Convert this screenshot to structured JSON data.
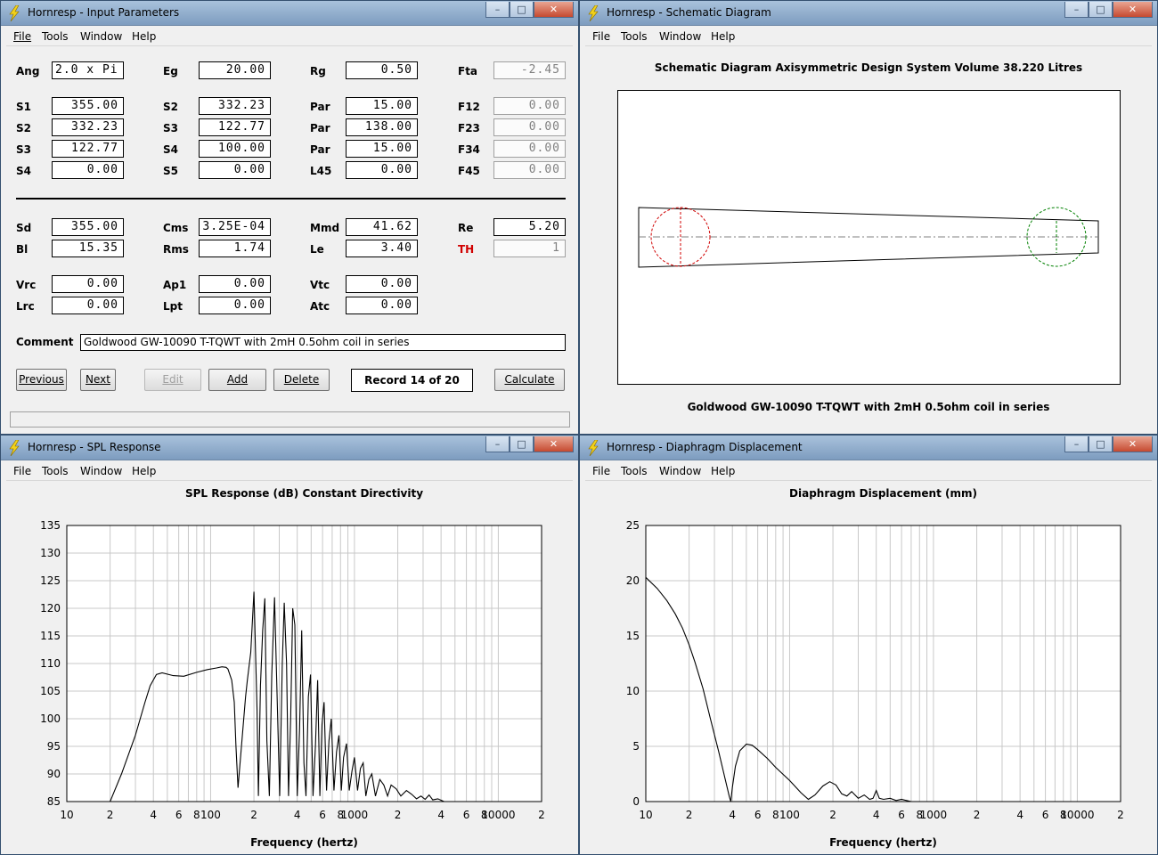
{
  "menu": {
    "file": "File",
    "tools": "Tools",
    "window": "Window",
    "help": "Help"
  },
  "input_window": {
    "title": "Hornresp - Input Parameters",
    "fields": [
      {
        "label": "Ang",
        "value": "2.0 x Pi"
      },
      {
        "label": "Eg",
        "value": "20.00"
      },
      {
        "label": "Rg",
        "value": "0.50"
      },
      {
        "label": "Fta",
        "value": "-2.45"
      },
      {
        "label": "S1",
        "value": "355.00"
      },
      {
        "label": "S2",
        "value": "332.23"
      },
      {
        "label": "Par",
        "value": "15.00"
      },
      {
        "label": "F12",
        "value": "0.00"
      },
      {
        "label": "S2",
        "value": "332.23"
      },
      {
        "label": "S3",
        "value": "122.77"
      },
      {
        "label": "Par",
        "value": "138.00"
      },
      {
        "label": "F23",
        "value": "0.00"
      },
      {
        "label": "S3",
        "value": "122.77"
      },
      {
        "label": "S4",
        "value": "100.00"
      },
      {
        "label": "Par",
        "value": "15.00"
      },
      {
        "label": "F34",
        "value": "0.00"
      },
      {
        "label": "S4",
        "value": "0.00"
      },
      {
        "label": "S5",
        "value": "0.00"
      },
      {
        "label": "L45",
        "value": "0.00"
      },
      {
        "label": "F45",
        "value": "0.00"
      },
      {
        "label": "Sd",
        "value": "355.00"
      },
      {
        "label": "Cms",
        "value": "3.25E-04"
      },
      {
        "label": "Mmd",
        "value": "41.62"
      },
      {
        "label": "Re",
        "value": "5.20"
      },
      {
        "label": "Bl",
        "value": "15.35"
      },
      {
        "label": "Rms",
        "value": "1.74"
      },
      {
        "label": "Le",
        "value": "3.40"
      },
      {
        "label": "TH",
        "value": "1"
      },
      {
        "label": "Vrc",
        "value": "0.00"
      },
      {
        "label": "Ap1",
        "value": "0.00"
      },
      {
        "label": "Vtc",
        "value": "0.00"
      },
      {
        "label": "Lrc",
        "value": "0.00"
      },
      {
        "label": "Lpt",
        "value": "0.00"
      },
      {
        "label": "Atc",
        "value": "0.00"
      }
    ],
    "comment_label": "Comment",
    "comment_value": "Goldwood GW-10090 T-TQWT with 2mH 0.5ohm coil in series",
    "buttons": {
      "previous": "Previous",
      "next": "Next",
      "edit": "Edit",
      "add": "Add",
      "delete": "Delete",
      "calculate": "Calculate"
    },
    "record": "Record 14 of 20"
  },
  "schematic_window": {
    "title": "Hornresp - Schematic Diagram",
    "header": "Schematic Diagram   Axisymmetric Design   System Volume 38.220 Litres",
    "caption": "Goldwood GW-10090 T-TQWT with 2mH 0.5ohm coil in series"
  },
  "spl_window": {
    "title": "Hornresp - SPL Response"
  },
  "disp_window": {
    "title": "Hornresp - Diaphragm Displacement"
  },
  "chart_data": [
    {
      "type": "line",
      "title": "SPL Response (dB)   Constant Directivity",
      "xlabel": "Frequency (hertz)",
      "ylabel": "",
      "xscale": "log",
      "xlim": [
        10,
        20000
      ],
      "ylim": [
        85,
        135
      ],
      "x_tick_labels": [
        "10",
        "2",
        "4",
        "6",
        "8",
        "100",
        "2",
        "4",
        "6",
        "8",
        "1000",
        "2",
        "4",
        "6",
        "8",
        "10000",
        "2"
      ],
      "y_tick_labels": [
        "135",
        "130",
        "125",
        "120",
        "115",
        "110",
        "105",
        "100",
        "95",
        "90",
        "85"
      ],
      "grid": true,
      "series": [
        {
          "x": [
            20,
            24,
            30,
            35,
            38,
            42,
            46,
            55,
            65,
            80,
            95,
            110,
            120,
            128,
            132,
            140,
            146,
            150,
            155,
            175,
            180,
            190,
            200,
            210,
            215,
            222,
            230,
            238,
            246,
            256,
            266,
            278,
            290,
            302,
            315,
            325,
            337,
            348,
            360,
            372,
            385,
            400,
            415,
            430,
            445,
            460,
            478,
            495,
            515,
            535,
            555,
            575,
            595,
            615,
            640,
            665,
            690,
            720,
            750,
            780,
            810,
            840,
            880,
            920,
            960,
            1000,
            1050,
            1100,
            1150,
            1200,
            1260,
            1320,
            1400,
            1500,
            1600,
            1700,
            1800,
            1950,
            2100,
            2300,
            2500,
            2700,
            2900,
            3100,
            3300,
            3500,
            3800,
            4200
          ],
          "values": [
            85,
            90,
            97,
            103,
            106,
            108,
            108.3,
            107.8,
            107.7,
            108.4,
            108.9,
            109.2,
            109.4,
            109.3,
            109,
            107,
            103,
            95,
            87.5,
            104,
            107,
            112,
            123,
            102,
            86,
            106,
            116,
            121.8,
            96,
            86,
            108,
            122,
            104,
            86,
            110,
            121,
            110,
            86,
            100,
            120,
            117,
            86,
            98,
            116,
            92,
            86,
            104,
            108,
            86,
            95,
            107,
            86,
            99,
            103,
            87,
            96,
            100,
            87,
            94,
            97,
            87,
            93,
            95.5,
            87,
            90.5,
            93,
            87,
            91,
            92,
            86,
            89,
            90,
            86,
            89,
            88,
            86,
            88,
            87.3,
            86,
            87,
            86.3,
            85.5,
            86,
            85.4,
            86.2,
            85.3,
            85.5,
            85
          ]
        }
      ]
    },
    {
      "type": "line",
      "title": "Diaphragm Displacement (mm)",
      "xlabel": "Frequency (hertz)",
      "ylabel": "",
      "xscale": "log",
      "xlim": [
        10,
        20000
      ],
      "ylim": [
        0,
        25
      ],
      "x_tick_labels": [
        "10",
        "2",
        "4",
        "6",
        "8",
        "100",
        "2",
        "4",
        "6",
        "8",
        "1000",
        "2",
        "4",
        "6",
        "8",
        "10000",
        "2"
      ],
      "y_tick_labels": [
        "25",
        "20",
        "15",
        "10",
        "5",
        "0"
      ],
      "grid": true,
      "series": [
        {
          "x": [
            10,
            12,
            14,
            16,
            18,
            20,
            22,
            25,
            28,
            32,
            36,
            38,
            39,
            40,
            42,
            45,
            50,
            55,
            60,
            70,
            80,
            100,
            120,
            135,
            150,
            170,
            190,
            210,
            230,
            250,
            270,
            300,
            330,
            360,
            380,
            400,
            420,
            450,
            500,
            550,
            600,
            650,
            700
          ],
          "values": [
            20.3,
            19.3,
            18.2,
            17,
            15.7,
            14.2,
            12.6,
            10.2,
            7.6,
            4.6,
            1.8,
            0.5,
            0,
            1.3,
            3.2,
            4.6,
            5.2,
            5.1,
            4.7,
            3.9,
            3.1,
            1.9,
            0.8,
            0.2,
            0.6,
            1.4,
            1.8,
            1.5,
            0.7,
            0.5,
            0.9,
            0.3,
            0.6,
            0.2,
            0.3,
            1,
            0.3,
            0.2,
            0.3,
            0.1,
            0.2,
            0.1,
            0
          ]
        }
      ]
    }
  ]
}
